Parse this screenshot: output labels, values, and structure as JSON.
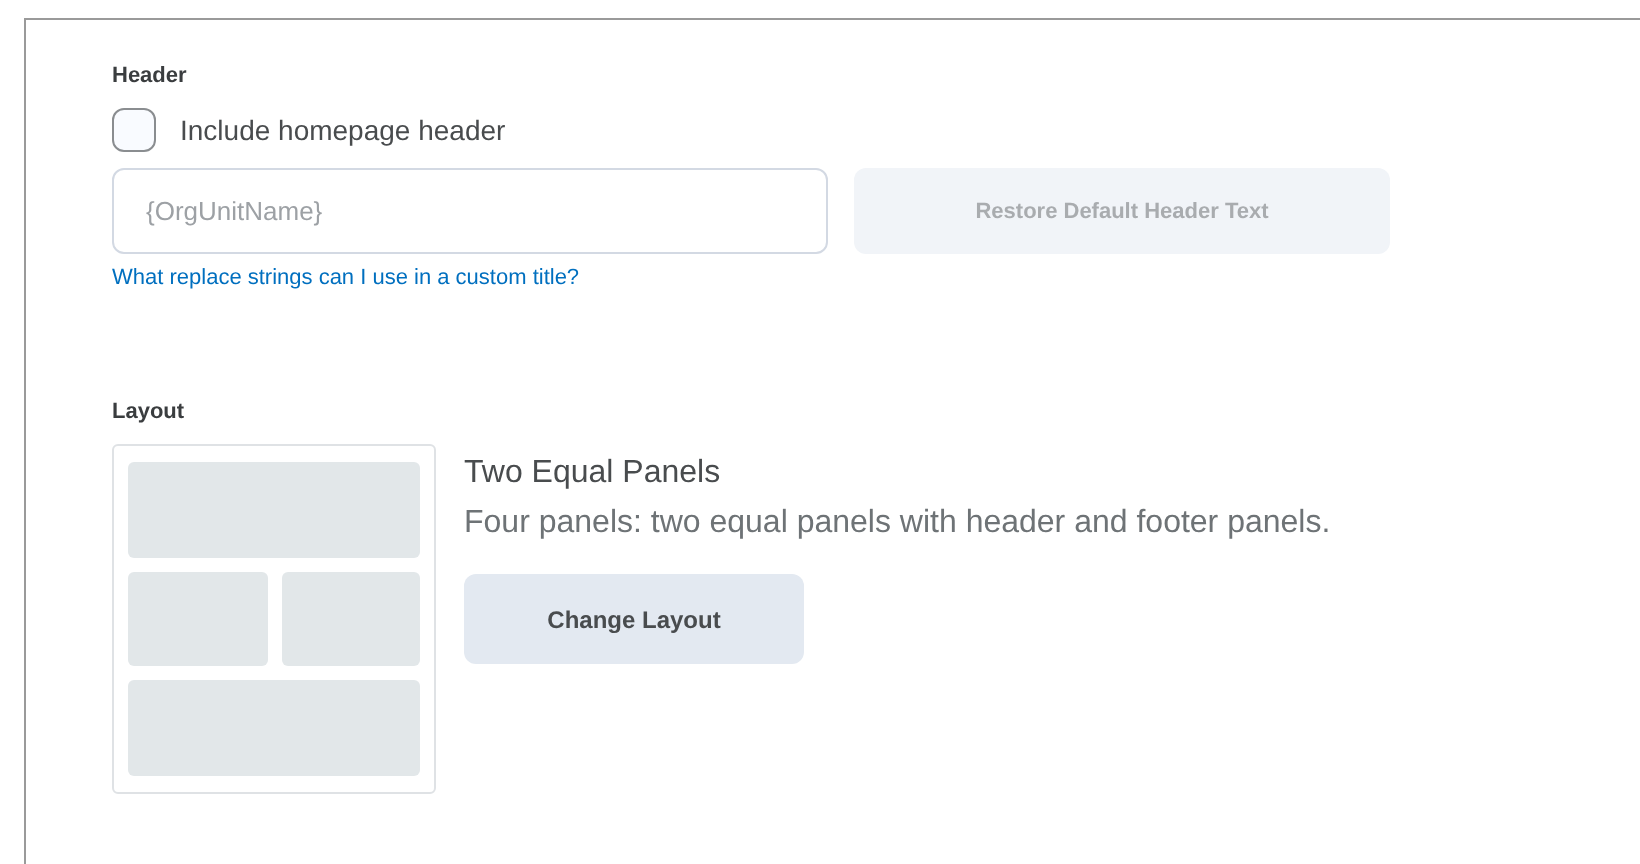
{
  "header_section": {
    "heading": "Header",
    "checkbox": {
      "label": "Include homepage header",
      "checked": false
    },
    "title_field": {
      "placeholder": "{OrgUnitName}"
    },
    "restore_button": {
      "label": "Restore Default Header Text",
      "disabled": true
    },
    "help_link": "What replace strings can I use in a custom title?"
  },
  "layout_section": {
    "heading": "Layout",
    "layout_name": "Two Equal Panels",
    "description": "Four panels: two equal panels with header and footer panels.",
    "change_button": "Change Layout"
  }
}
